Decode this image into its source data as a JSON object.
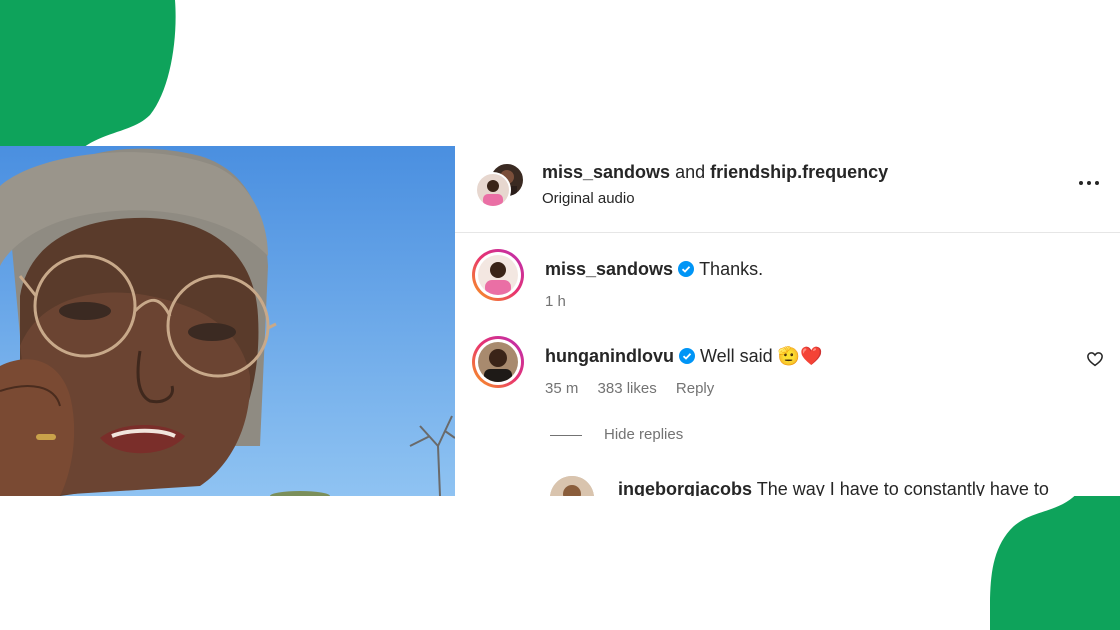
{
  "header": {
    "author1": "miss_sandows",
    "conjunction": "and",
    "author2": "friendship.frequency",
    "audio": "Original audio"
  },
  "comments": [
    {
      "username": "miss_sandows",
      "verified": true,
      "text": "Thanks.",
      "time": "1 h"
    },
    {
      "username": "hunganindlovu",
      "verified": true,
      "text": "Well said 🫡❤️",
      "time": "35 m",
      "likes": "383 likes",
      "reply_label": "Reply"
    }
  ],
  "hide_replies": "Hide replies",
  "reply": {
    "username": "ingeborgjacobs",
    "text": "The way I have to constantly have to"
  },
  "colors": {
    "accent_green": "#0ea35b",
    "verified_blue": "#0095f6",
    "heart_red": "#e0242f"
  }
}
